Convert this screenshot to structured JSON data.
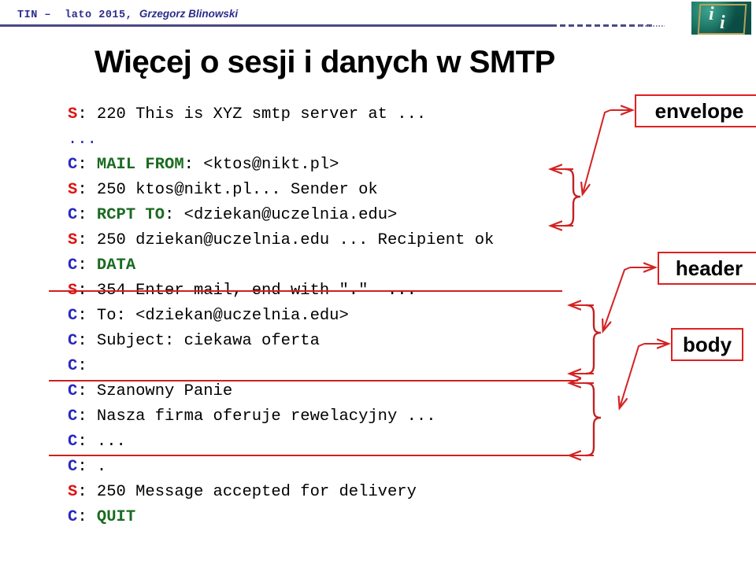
{
  "header": {
    "course": "TIN –  lato 2015, ",
    "author": "Grzegorz Blinowski",
    "logo_alt": "ii-logo"
  },
  "title": "Więcej o sesji i danych w SMTP",
  "transcript": {
    "lines": [
      {
        "prefix": "S",
        "cmd": "",
        "text": "220 This is XYZ smtp server at ..."
      },
      {
        "prefix": "",
        "cmd": "",
        "text": "..."
      },
      {
        "prefix": "C",
        "cmd": "MAIL FROM",
        "text": ": <ktos@nikt.pl>"
      },
      {
        "prefix": "S",
        "cmd": "",
        "text": "250 ktos@nikt.pl... Sender ok"
      },
      {
        "prefix": "C",
        "cmd": "RCPT TO",
        "text": ": <dziekan@uczelnia.edu>"
      },
      {
        "prefix": "S",
        "cmd": "",
        "text": "250 dziekan@uczelnia.edu ... Recipient ok"
      },
      {
        "prefix": "C",
        "cmd": "DATA",
        "text": ""
      },
      {
        "prefix": "S",
        "cmd": "",
        "text": "354 Enter mail, end with \".\"  ..."
      },
      {
        "prefix": "C",
        "cmd": "",
        "text": "To: <dziekan@uczelnia.edu>"
      },
      {
        "prefix": "C",
        "cmd": "",
        "text": "Subject: ciekawa oferta"
      },
      {
        "prefix": "C",
        "cmd": "",
        "text": ""
      },
      {
        "prefix": "C",
        "cmd": "",
        "text": "Szanowny Panie"
      },
      {
        "prefix": "C",
        "cmd": "",
        "text": "Nasza firma oferuje rewelacyjny ..."
      },
      {
        "prefix": "C",
        "cmd": "",
        "text": "..."
      },
      {
        "prefix": "C",
        "cmd": "",
        "text": "."
      },
      {
        "prefix": "S",
        "cmd": "",
        "text": "250 Message accepted for delivery"
      },
      {
        "prefix": "C",
        "cmd": "QUIT",
        "text": ""
      }
    ]
  },
  "annotations": {
    "envelope_label": "envelope",
    "header_label": "header",
    "body_label": "body"
  },
  "colors": {
    "server_prefix": "#e01010",
    "client_prefix": "#2727c0",
    "command": "#1a6b20",
    "annotation": "#e02020",
    "header_text": "#2c2c8c"
  }
}
